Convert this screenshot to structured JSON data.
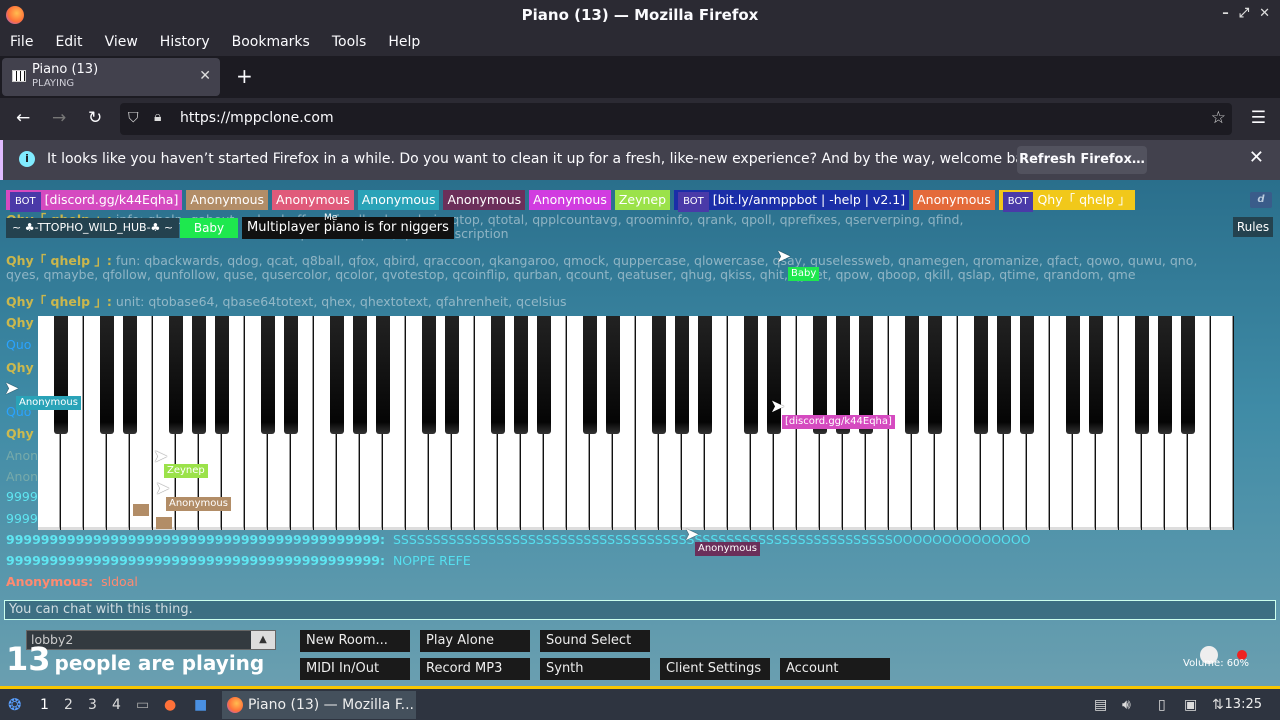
{
  "window": {
    "title": "Piano (13) — Mozilla Firefox"
  },
  "menu": [
    "File",
    "Edit",
    "View",
    "History",
    "Bookmarks",
    "Tools",
    "Help"
  ],
  "tab": {
    "title": "Piano (13)",
    "status": "PLAYING"
  },
  "address": {
    "url": "https://mppclone.com"
  },
  "notification": {
    "message": "It looks like you haven’t started Firefox in a while. Do you want to clean it up for a fresh, like-new experience? And by the way, welcome back!",
    "button": "Refresh Firefox…"
  },
  "users": [
    {
      "bot": true,
      "name": "[discord.gg/k44Eqha]",
      "color": "#d54ac0"
    },
    {
      "bot": false,
      "name": "Anonymous",
      "color": "#b28d67"
    },
    {
      "bot": false,
      "name": "Anonymous",
      "color": "#e05a7a"
    },
    {
      "bot": false,
      "name": "Anonymous",
      "color": "#2aa3b8"
    },
    {
      "bot": false,
      "name": "Anonymous",
      "color": "#6b2f5a"
    },
    {
      "bot": false,
      "name": "Anonymous",
      "color": "#d13ce0"
    },
    {
      "bot": false,
      "name": "Zeynep",
      "color": "#9be24a"
    },
    {
      "bot": true,
      "name": "[bit.ly/anmppbot | -help | v2.1]",
      "color": "#1a2ea8"
    },
    {
      "bot": false,
      "name": "Anonymous",
      "color": "#e46a3a"
    },
    {
      "bot": true,
      "name": "Qhy「 qhelp 」",
      "color": "#f1c81a"
    }
  ],
  "room_tag": "~ ♣-TTOPHO_WILD_HUB-♣ ~",
  "baby_tag": "Baby",
  "mp_tag": "Multiplayer piano is for niggers",
  "me_label": "Me",
  "rules": "Rules",
  "discord_icon": "discord-icon",
  "chat": {
    "line1_name": "Qhy「 qhelp 」:",
    "line1_text": "info: qhelp, qabout, qclearbuffer, qfeedback, qwhois, qtop, qtotal, qpplcountavg, qroominfo, qrank, qpoll, qprefixes, qserverping, qfind,",
    "line1b_text": "qsetdescription, qcleardescription",
    "line2_name": "Qhy「 qhelp 」:",
    "line2_text": "fun: qbackwards, qdog, qcat, q8ball, qfox, qbird, qraccoon, qkangaroo, qmock, quppercase, qlowercase, qsay, quselessweb, qnamegen, qromanize, qfact, qowo, quwu, qno,",
    "line2b_text": "qyes, qmaybe, qfollow, qunfollow, quse, qusercolor, qcolor, qvotestop, qcoinflip, qurban, qcount, qeatuser, qhug, qkiss, qhit, qyeet, qpow, qboop, qkill, qslap, qtime, qrandom, qme",
    "line3_name": "Qhy「 qhelp 」:",
    "line3_text": "unit: qtobase64, qbase64totext, qhex, qhextotext, qfahrenheit, qcelsius",
    "nine_name": "9999999999999999999999999999999999999999999:",
    "nine_text": "SSSSSSSSSSSSSSSSSSSSSSSSSSSSSSSSSSSSSSSSSSSSSSSSSSSSSSSSSSSSSSSOOOOOOOOOOOOOO",
    "nine2_name": "9999999999999999999999999999999999999999999:",
    "nine2_text": "NOPPE REFE",
    "anon_name": "Anonymous:",
    "anon_text": "sldoal",
    "side_names": [
      "Qhy",
      "Quo",
      "Qhy",
      "Quo",
      "Qhy",
      "Anon",
      "Anon",
      "9999",
      "9999"
    ]
  },
  "cursors": [
    {
      "name": "Baby",
      "color": "#1ee84e"
    },
    {
      "name": "Anonymous",
      "color": "#2aa3b8"
    },
    {
      "name": "[discord.gg/k44Eqha]",
      "color": "#d54ac0"
    },
    {
      "name": "Zeynep",
      "color": "#9be24a"
    },
    {
      "name": "Anonymous",
      "color": "#b28d67"
    },
    {
      "name": "Anonymous",
      "color": "#6b2f5a"
    }
  ],
  "chat_input": {
    "placeholder": "You can chat with this thing."
  },
  "room_select": "lobby2",
  "player_count": {
    "num": "13",
    "label": "people are playing"
  },
  "buttons": {
    "new_room": "New Room...",
    "play_alone": "Play Alone",
    "sound_select": "Sound Select",
    "midi": "MIDI In/Out",
    "record": "Record MP3",
    "synth": "Synth",
    "client_settings": "Client Settings",
    "account": "Account"
  },
  "volume": "Volume: 60%",
  "taskbar": {
    "workspaces": [
      "1",
      "2",
      "3",
      "4"
    ],
    "app_title": "Piano (13) — Mozilla F...",
    "clock": "13:25"
  }
}
